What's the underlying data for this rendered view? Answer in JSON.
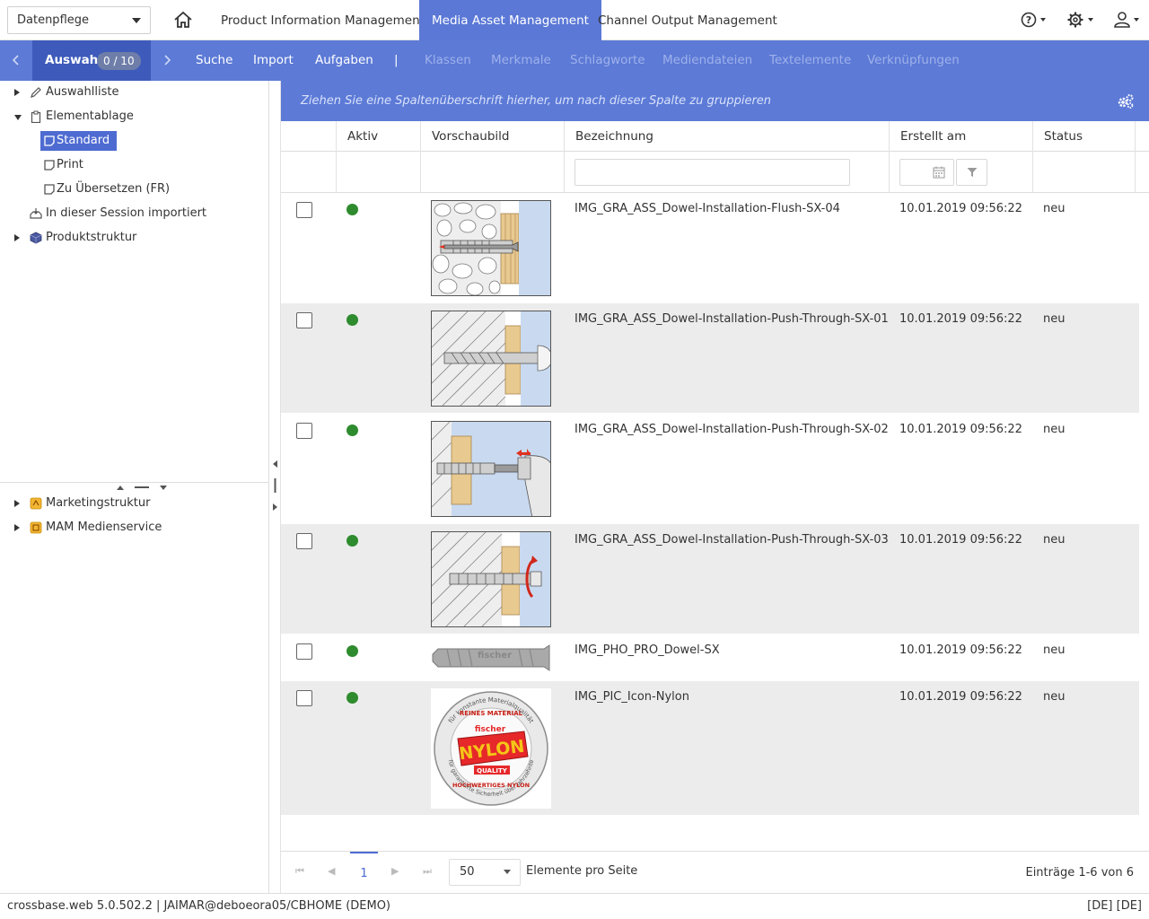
{
  "topbar": {
    "db_select": "Datenpflege",
    "tabs": [
      {
        "label": "Product Information Management"
      },
      {
        "label": "Media Asset Management"
      },
      {
        "label": "Channel Output Management"
      }
    ],
    "active_tab": "Media Asset Management"
  },
  "subnav": {
    "auswahl_label": "Auswahl",
    "auswahl_count": "0 / 10",
    "items": [
      "Suche",
      "Import",
      "Aufgaben"
    ],
    "separator": "|",
    "dim_items": [
      "Klassen",
      "Merkmale",
      "Schlagworte",
      "Mediendateien",
      "Textelemente",
      "Verknüpfungen"
    ]
  },
  "sidebar": {
    "tree_top": [
      {
        "label": "Auswahlliste",
        "icon": "pencil-icon"
      },
      {
        "label": "Elementablage",
        "icon": "clipboard-icon"
      },
      {
        "label": "Standard",
        "icon": "note-icon"
      },
      {
        "label": "Print",
        "icon": "note-icon"
      },
      {
        "label": "Zu Übersetzen (FR)",
        "icon": "note-icon"
      },
      {
        "label": "In dieser Session importiert",
        "icon": "import-icon"
      },
      {
        "label": "Produktstruktur",
        "icon": "cube-icon"
      }
    ],
    "tree_bottom": [
      {
        "label": "Marketingstruktur",
        "icon": "marketing-icon"
      },
      {
        "label": "MAM Medienservice",
        "icon": "media-service-icon"
      }
    ]
  },
  "grid": {
    "group_hint": "Ziehen Sie eine Spaltenüberschrift hierher, um nach dieser Spalte zu gruppieren",
    "columns": [
      "Aktiv",
      "Vorschaubild",
      "Bezeichnung",
      "Erstellt am",
      "Status"
    ],
    "rows": [
      {
        "name": "IMG_GRA_ASS_Dowel-Installation-Flush-SX-04",
        "created": "10.01.2019 09:56:22",
        "status": "neu"
      },
      {
        "name": "IMG_GRA_ASS_Dowel-Installation-Push-Through-SX-01",
        "created": "10.01.2019 09:56:22",
        "status": "neu"
      },
      {
        "name": "IMG_GRA_ASS_Dowel-Installation-Push-Through-SX-02",
        "created": "10.01.2019 09:56:22",
        "status": "neu"
      },
      {
        "name": "IMG_GRA_ASS_Dowel-Installation-Push-Through-SX-03",
        "created": "10.01.2019 09:56:22",
        "status": "neu"
      },
      {
        "name": "IMG_PHO_PRO_Dowel-SX",
        "created": "10.01.2019 09:56:22",
        "status": "neu"
      },
      {
        "name": "IMG_PIC_Icon-Nylon",
        "created": "10.01.2019 09:56:22",
        "status": "neu"
      }
    ],
    "thumb_text": {
      "dowel": "fischer",
      "badge_brand": "fischer",
      "badge_word": "NYLON",
      "badge_quality": "QUALITY",
      "badge_ring_top": "für konstante Materialqualität",
      "badge_top": "REINES MATERIAL",
      "badge_bottom": "HOCHWERTIGES NYLON",
      "badge_ring_bottom": "für garantierte Sicherheit über Jahrzehnte"
    }
  },
  "pager": {
    "page": "1",
    "page_size": "50",
    "page_size_label": "Elemente pro Seite",
    "summary": "Einträge 1-6 von 6"
  },
  "footer": {
    "left": "crossbase.web 5.0.502.2 | JAIMAR@deboeora05/CBHOME (DEMO)",
    "right": "[DE] [DE]"
  },
  "colors": {
    "accent": "#5c7ad6",
    "accent_dark": "#3e5bbb",
    "active_green": "#2e8b2e"
  }
}
